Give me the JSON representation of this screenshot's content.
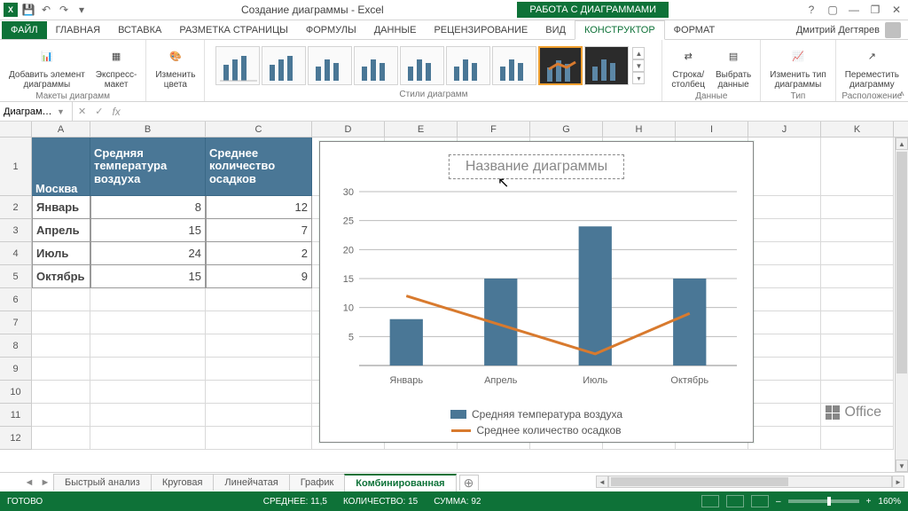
{
  "app": {
    "title": "Создание диаграммы - Excel",
    "contextual_title": "РАБОТА С ДИАГРАММАМИ",
    "user": "Дмитрий Дегтярев"
  },
  "tabs": {
    "file": "ФАЙЛ",
    "items": [
      "ГЛАВНАЯ",
      "ВСТАВКА",
      "РАЗМЕТКА СТРАНИЦЫ",
      "ФОРМУЛЫ",
      "ДАННЫЕ",
      "РЕЦЕНЗИРОВАНИЕ",
      "ВИД",
      "КОНСТРУКТОР",
      "ФОРМАТ"
    ],
    "active": "КОНСТРУКТОР"
  },
  "ribbon": {
    "group_layouts": "Макеты диаграмм",
    "group_styles": "Стили диаграмм",
    "group_data": "Данные",
    "group_type": "Тип",
    "group_loc": "Расположение",
    "btn_add_element": "Добавить элемент\nдиаграммы",
    "btn_express": "Экспресс-\nмакет",
    "btn_colors": "Изменить\nцвета",
    "btn_rowcol": "Строка/\nстолбец",
    "btn_select": "Выбрать\nданные",
    "btn_change_type": "Изменить тип\nдиаграммы",
    "btn_move": "Переместить\nдиаграмму"
  },
  "namebox": "Диаграм…",
  "columns": [
    "A",
    "B",
    "C",
    "D",
    "E",
    "F",
    "G",
    "H",
    "I",
    "J",
    "K"
  ],
  "table": {
    "city": "Москва",
    "col_b": "Средняя температура воздуха",
    "col_c": "Среднее количество осадков",
    "rows": [
      {
        "label": "Январь",
        "b": 8,
        "c": 12
      },
      {
        "label": "Апрель",
        "b": 15,
        "c": 7
      },
      {
        "label": "Июль",
        "b": 24,
        "c": 2
      },
      {
        "label": "Октябрь",
        "b": 15,
        "c": 9
      }
    ]
  },
  "chart": {
    "title_placeholder": "Название диаграммы",
    "legend_bar": "Средняя температура воздуха",
    "legend_line": "Среднее количество осадков"
  },
  "chart_data": {
    "type": "bar",
    "categories": [
      "Январь",
      "Апрель",
      "Июль",
      "Октябрь"
    ],
    "series": [
      {
        "name": "Средняя температура воздуха",
        "kind": "bar",
        "values": [
          8,
          15,
          24,
          15
        ]
      },
      {
        "name": "Среднее количество осадков",
        "kind": "line",
        "values": [
          12,
          7,
          2,
          9
        ]
      }
    ],
    "ylim": [
      0,
      30
    ],
    "yticks": [
      5,
      10,
      15,
      20,
      25,
      30
    ],
    "title": "Название диаграммы"
  },
  "sheet_tabs": [
    "Быстрый анализ",
    "Круговая",
    "Линейчатая",
    "График",
    "Комбинированная"
  ],
  "sheet_tabs_active": "Комбинированная",
  "status": {
    "ready": "ГОТОВО",
    "avg_label": "СРЕДНЕЕ:",
    "avg": "11,5",
    "count_label": "КОЛИЧЕСТВО:",
    "count": "15",
    "sum_label": "СУММА:",
    "sum": "92",
    "zoom": "160%"
  },
  "office_brand": "Office"
}
